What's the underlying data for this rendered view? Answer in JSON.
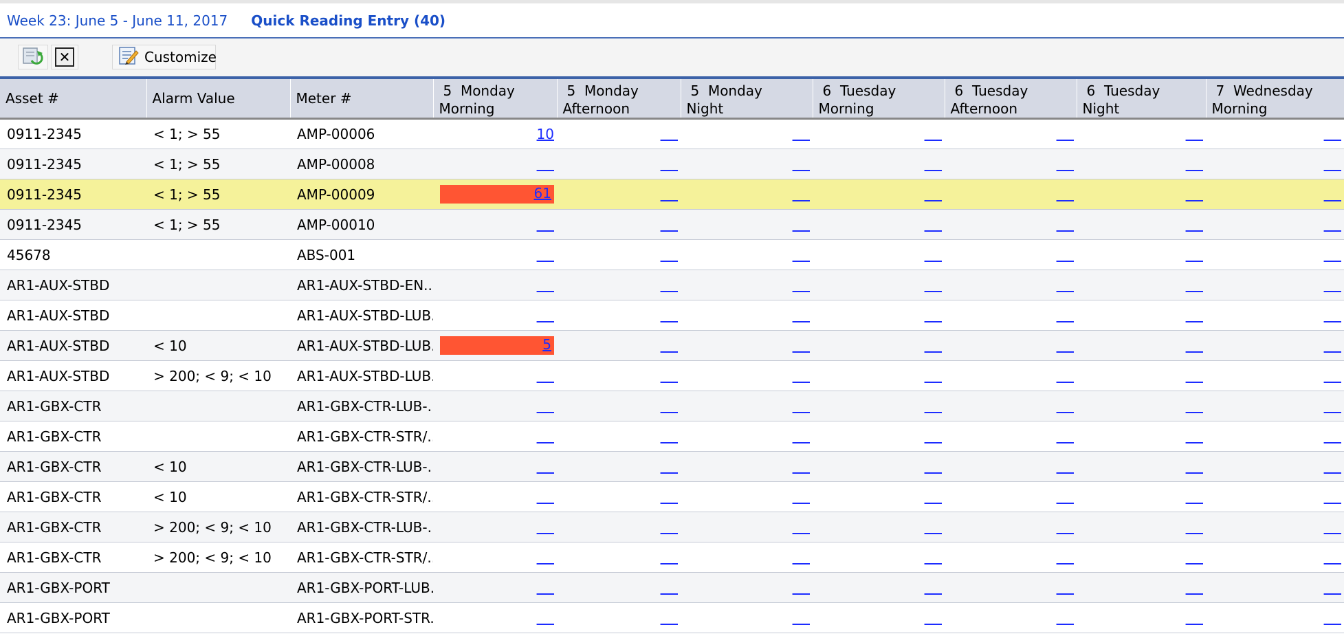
{
  "header": {
    "week_title": "Week 23: June 5 - June 11, 2017",
    "app_title": "Quick Reading Entry (40)"
  },
  "toolbar": {
    "refresh_icon": "refresh-icon",
    "close_icon": "close-icon",
    "customize_icon": "customize-icon",
    "customize_label": "Customize"
  },
  "columns": {
    "asset": "Asset #",
    "alarm": "Alarm Value",
    "meter": "Meter #",
    "slots": [
      {
        "l1": "5  Monday",
        "l2": "Morning"
      },
      {
        "l1": "5  Monday",
        "l2": "Afternoon"
      },
      {
        "l1": "5  Monday",
        "l2": "Night"
      },
      {
        "l1": "6  Tuesday",
        "l2": "Morning"
      },
      {
        "l1": "6  Tuesday",
        "l2": "Afternoon"
      },
      {
        "l1": "6  Tuesday",
        "l2": "Night"
      },
      {
        "l1": "7  Wednesday",
        "l2": "Morning"
      }
    ]
  },
  "rows": [
    {
      "asset": "0911-2345",
      "alarm": "< 1; > 55",
      "meter": "AMP-00006",
      "first_value": "10",
      "first_alarm": false
    },
    {
      "asset": "0911-2345",
      "alarm": "< 1; > 55",
      "meter": "AMP-00008",
      "first_value": "",
      "first_alarm": false
    },
    {
      "asset": "0911-2345",
      "alarm": "< 1; > 55",
      "meter": "AMP-00009",
      "first_value": "61",
      "first_alarm": true,
      "selected": true
    },
    {
      "asset": "0911-2345",
      "alarm": "< 1; > 55",
      "meter": "AMP-00010",
      "first_value": "",
      "first_alarm": false
    },
    {
      "asset": "45678",
      "alarm": "",
      "meter": "ABS-001",
      "first_value": "",
      "first_alarm": false
    },
    {
      "asset": "AR1-AUX-STBD",
      "alarm": "",
      "meter": "AR1-AUX-STBD-EN...",
      "first_value": "",
      "first_alarm": false
    },
    {
      "asset": "AR1-AUX-STBD",
      "alarm": "",
      "meter": "AR1-AUX-STBD-LUB..",
      "first_value": "",
      "first_alarm": false
    },
    {
      "asset": "AR1-AUX-STBD",
      "alarm": "< 10",
      "meter": "AR1-AUX-STBD-LUB..",
      "first_value": "5",
      "first_alarm": true
    },
    {
      "asset": "AR1-AUX-STBD",
      "alarm": "> 200; < 9; < 10",
      "meter": "AR1-AUX-STBD-LUB..",
      "first_value": "",
      "first_alarm": false
    },
    {
      "asset": "AR1-GBX-CTR",
      "alarm": "",
      "meter": "AR1-GBX-CTR-LUB-...",
      "first_value": "",
      "first_alarm": false
    },
    {
      "asset": "AR1-GBX-CTR",
      "alarm": "",
      "meter": "AR1-GBX-CTR-STR/...",
      "first_value": "",
      "first_alarm": false
    },
    {
      "asset": "AR1-GBX-CTR",
      "alarm": "< 10",
      "meter": "AR1-GBX-CTR-LUB-...",
      "first_value": "",
      "first_alarm": false
    },
    {
      "asset": "AR1-GBX-CTR",
      "alarm": "< 10",
      "meter": "AR1-GBX-CTR-STR/...",
      "first_value": "",
      "first_alarm": false
    },
    {
      "asset": "AR1-GBX-CTR",
      "alarm": "> 200; < 9; < 10",
      "meter": "AR1-GBX-CTR-LUB-...",
      "first_value": "",
      "first_alarm": false
    },
    {
      "asset": "AR1-GBX-CTR",
      "alarm": "> 200; < 9; < 10",
      "meter": "AR1-GBX-CTR-STR/...",
      "first_value": "",
      "first_alarm": false
    },
    {
      "asset": "AR1-GBX-PORT",
      "alarm": "",
      "meter": "AR1-GBX-PORT-LUB..",
      "first_value": "",
      "first_alarm": false
    },
    {
      "asset": "AR1-GBX-PORT",
      "alarm": "",
      "meter": "AR1-GBX-PORT-STR..",
      "first_value": "",
      "first_alarm": false
    }
  ],
  "colors": {
    "link": "#1c2cff",
    "alarm": "#ff5533",
    "selected_row": "#f5f29a",
    "header_bg": "#d5d9e4",
    "title": "#1a4fc8"
  }
}
